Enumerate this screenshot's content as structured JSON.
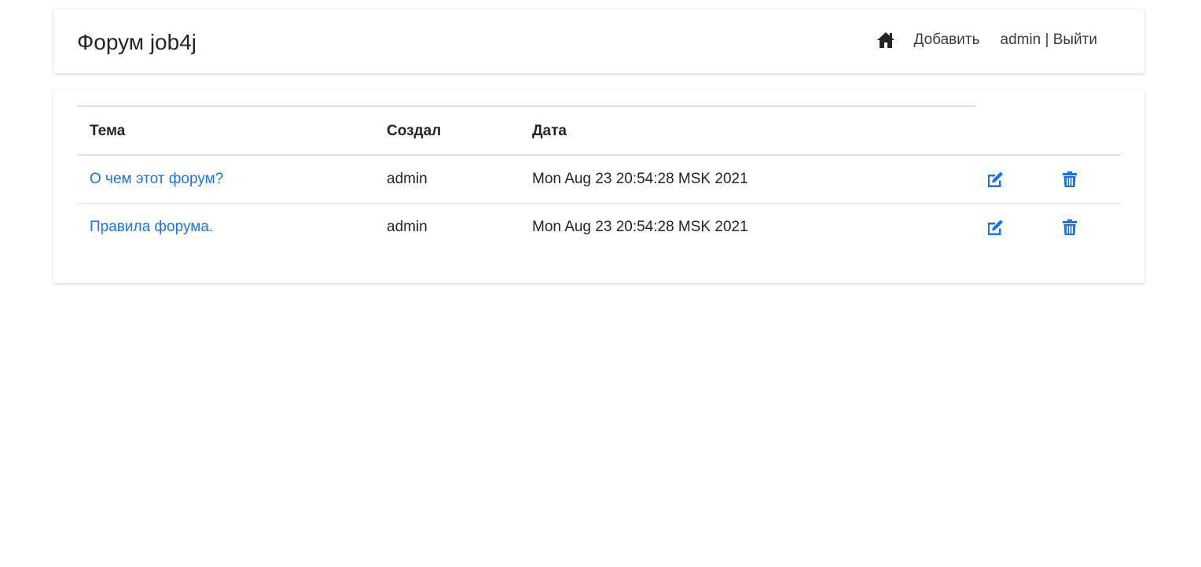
{
  "header": {
    "brand": "Форум job4j",
    "nav": {
      "home_icon": "home-icon",
      "add_label": "Добавить",
      "user_label": "admin | Выйти"
    }
  },
  "table": {
    "columns": [
      "Тема",
      "Создал",
      "Дата"
    ],
    "rows": [
      {
        "topic": "О чем этот форум?",
        "author": "admin",
        "date": "Mon Aug 23 20:54:28 MSK 2021",
        "edit_icon": "edit-icon",
        "delete_icon": "trash-icon"
      },
      {
        "topic": "Правила форума.",
        "author": "admin",
        "date": "Mon Aug 23 20:54:28 MSK 2021",
        "edit_icon": "edit-icon",
        "delete_icon": "trash-icon"
      }
    ]
  },
  "colors": {
    "link": "#1a73e8",
    "text": "#212529",
    "border": "#dee2e6"
  }
}
